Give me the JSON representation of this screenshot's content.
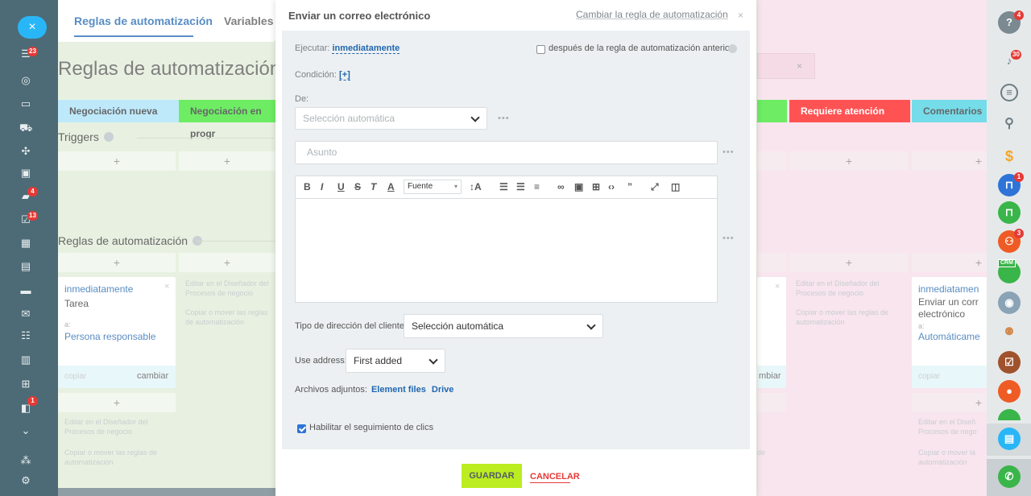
{
  "left_sidebar": {
    "close_label": "×",
    "badges": {
      "tasks": "23",
      "chat": "4",
      "feed": "13",
      "crm": "1"
    }
  },
  "background": {
    "tabs": [
      "Reglas de automatización",
      "Variables"
    ],
    "page_title": "Reglas de automatización y d",
    "stages": [
      "Negociación nueva",
      "Negociación en progr",
      "Requiere atención",
      "Comentarios"
    ],
    "triggers_title": "Triggers",
    "rules_title": "Reglas de automatización",
    "card_left": {
      "title": "inmediatamente",
      "task": "Tarea",
      "to_label": "a:",
      "assignee": "Persona responsable",
      "copy": "copiar",
      "change": "cambiar"
    },
    "hint_edit": "Editar en el Diseñador del Procesos de negocio",
    "hint_copy": "Copiar o mover las reglas de automatización",
    "card_right": {
      "title": "inmediatamen",
      "action": "Enviar un corr electrónico",
      "to_label": "a:",
      "assignee": "Automáticame",
      "copy": "copiar"
    },
    "card_mid_change": "mbiar",
    "plus": "+",
    "close_x": "×"
  },
  "modal": {
    "title": "Enviar un correo electrónico",
    "change_rule": "Cambiar la regla de automatización",
    "close": "×",
    "execute_label": "Ejecutar:",
    "execute_value": "inmediatamente",
    "after_previous_label": "después de la regla de automatización anterior",
    "condition_label": "Condición:",
    "condition_value": "[+]",
    "from_label": "De:",
    "from_placeholder": "Selección automática",
    "subject_placeholder": "Asunto",
    "toolbar": {
      "font": "Fuente"
    },
    "address_type_label": "Tipo de dirección del cliente:",
    "address_type_value": "Selección automática",
    "use_address_label": "Use address:",
    "use_address_value": "First added",
    "attachments_label": "Archivos adjuntos:",
    "attachments_element_files": "Element files",
    "attachments_drive": "Drive",
    "tracking_label": "Habilitar el seguimiento de clics",
    "tracking_checked": true,
    "save_label": "GUARDAR",
    "cancel_label": "CANCELAR",
    "more_dots": "•••"
  },
  "right_sidebar": {
    "badges": {
      "help": "4",
      "notifications": "30",
      "lock": "1",
      "group": "3"
    },
    "crm_tag": "CRM"
  },
  "colors": {
    "accent_blue": "#2067b0",
    "save_green": "#bbed21",
    "stage_blue": "#a8e2fa",
    "stage_green": "#3de631",
    "stage_red": "#ff1a1a",
    "stage_cyan": "#47d1e2"
  }
}
